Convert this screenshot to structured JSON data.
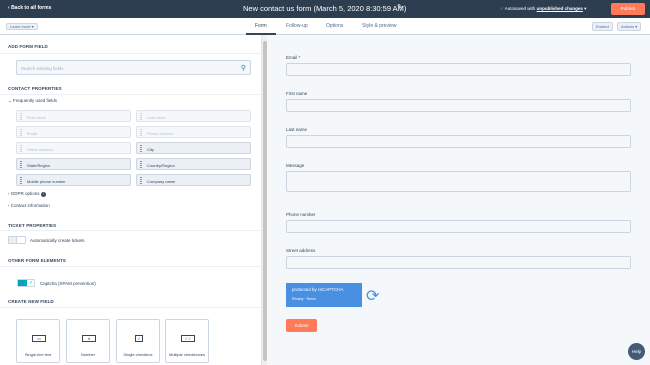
{
  "topbar": {
    "back_label": "Back to all forms",
    "title": "New contact us form (March 5, 2020 8:30:59 AM)",
    "autosave_prefix": "Autosaved with",
    "autosave_link": "unpublished changes",
    "publish_label": "Publish"
  },
  "subbar": {
    "learn_label": "Learn more ▾",
    "tabs": [
      "Form",
      "Follow-up",
      "Options",
      "Style & preview"
    ],
    "embed_label": "Embed",
    "actions_label": "Actions ▾"
  },
  "left": {
    "add_field_title": "ADD FORM FIELD",
    "search_placeholder": "Search existing fields",
    "contact_props_title": "CONTACT PROPERTIES",
    "frequently_used_label": "Frequently used fields",
    "fields": [
      "First name",
      "Last name",
      "Email",
      "Phone number",
      "Street address",
      "City",
      "State/Region",
      "Country/Region",
      "Mobile phone number",
      "Company name"
    ],
    "gdpr_label": "GDPR options",
    "contact_info_label": "Contact information",
    "ticket_title": "TICKET PROPERTIES",
    "ticket_toggle_label": "Automatically create tickets",
    "other_title": "OTHER FORM ELEMENTS",
    "captcha_label": "Captcha (SPAM prevention)",
    "create_title": "CREATE NEW FIELD",
    "new_fields": [
      "Single-line text",
      "Number",
      "Single checkbox",
      "Multiple checkboxes"
    ]
  },
  "form": {
    "labels": [
      "Email *",
      "First name",
      "Last name",
      "Message",
      "Phone number",
      "Street address"
    ],
    "recaptcha_text": "protected by reCAPTCHA",
    "recaptcha_links": "Privacy · Terms",
    "submit_label": "Submit"
  },
  "help_label": "Help",
  "colors": {
    "accent": "#ff7a59",
    "dark": "#2d3e50",
    "teal": "#00a4bd"
  }
}
